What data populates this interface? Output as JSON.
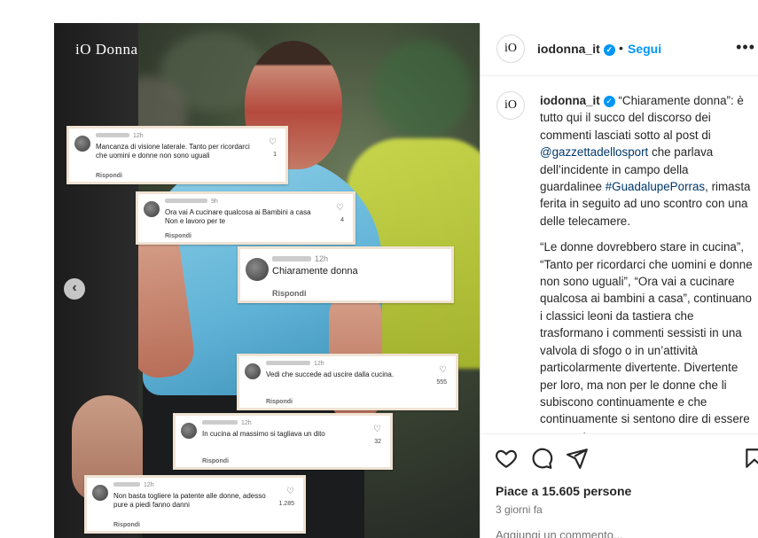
{
  "brand": "iO Donna",
  "comments": [
    {
      "user": "",
      "time": "12h",
      "text": "Mancanza di visione laterale. Tanto per ricordarci che uomini e donne non sono uguali",
      "likes": "1",
      "reply": "Rispondi"
    },
    {
      "user": "",
      "time": "9h",
      "text": "Ora vai A cucinare qualcosa ai Bambini a casa Non e lavoro per te",
      "likes": "4",
      "reply": "Rispondi"
    },
    {
      "user": "",
      "time": "12h",
      "text": "Chiaramente donna",
      "likes": "",
      "reply": "Rispondi"
    },
    {
      "user": "",
      "time": "12h",
      "text": "Vedi che succede ad uscire dalla cucina.",
      "likes": "555",
      "reply": "Rispondi"
    },
    {
      "user": "",
      "time": "12h",
      "text": "In cucina al massimo si tagliava un dito",
      "likes": "32",
      "reply": "Rispondi"
    },
    {
      "user": "",
      "time": "12h",
      "text": "Non basta togliere la patente alle donne, adesso pure a piedi fanno danni",
      "likes": "1.285",
      "reply": "Rispondi"
    }
  ],
  "header": {
    "logo_text": "iO",
    "username": "iodonna_it",
    "verified_mark": "✓",
    "dot": "•",
    "follow": "Segui",
    "more": "•••"
  },
  "caption": {
    "username": "iodonna_it",
    "p1_a": "“Chiaramente donna”: è tutto qui il succo del discorso dei commenti lasciati sotto al post di ",
    "mention": "@gazzettadellosport",
    "p1_b": " che parlava dell’incidente in campo della guardalinee ",
    "hashtag": "#GuadalupePorras",
    "p1_c": ", rimasta ferita in seguito ad uno scontro con una delle telecamere.",
    "p2": "“Le donne dovrebbero stare in cucina”, “Tanto per ricordarci che uomini e donne non sono uguali”, “Ora vai a cucinare qualcosa ai bambini a casa”, continuano i classici leoni da tastiera che trasformano i commenti sessisti in una valvola di sfogo o in un’attività particolarmente divertente. Divertente per loro, ma non per le donne che li subiscono continuamente e che continuamente si sentono dire di essere esagerate e"
  },
  "actions": {
    "like_icon": "heart-icon",
    "comment_icon": "comment-icon",
    "share_icon": "share-icon",
    "save_icon": "bookmark-icon",
    "likes_text": "Piace a 15.605 persone",
    "date_text": "3 giorni fa",
    "comment_preview": "Aggiungi un commento..."
  },
  "colors": {
    "accent": "#0095f6",
    "link": "#00376b",
    "comment_border": "#efe3d4"
  }
}
